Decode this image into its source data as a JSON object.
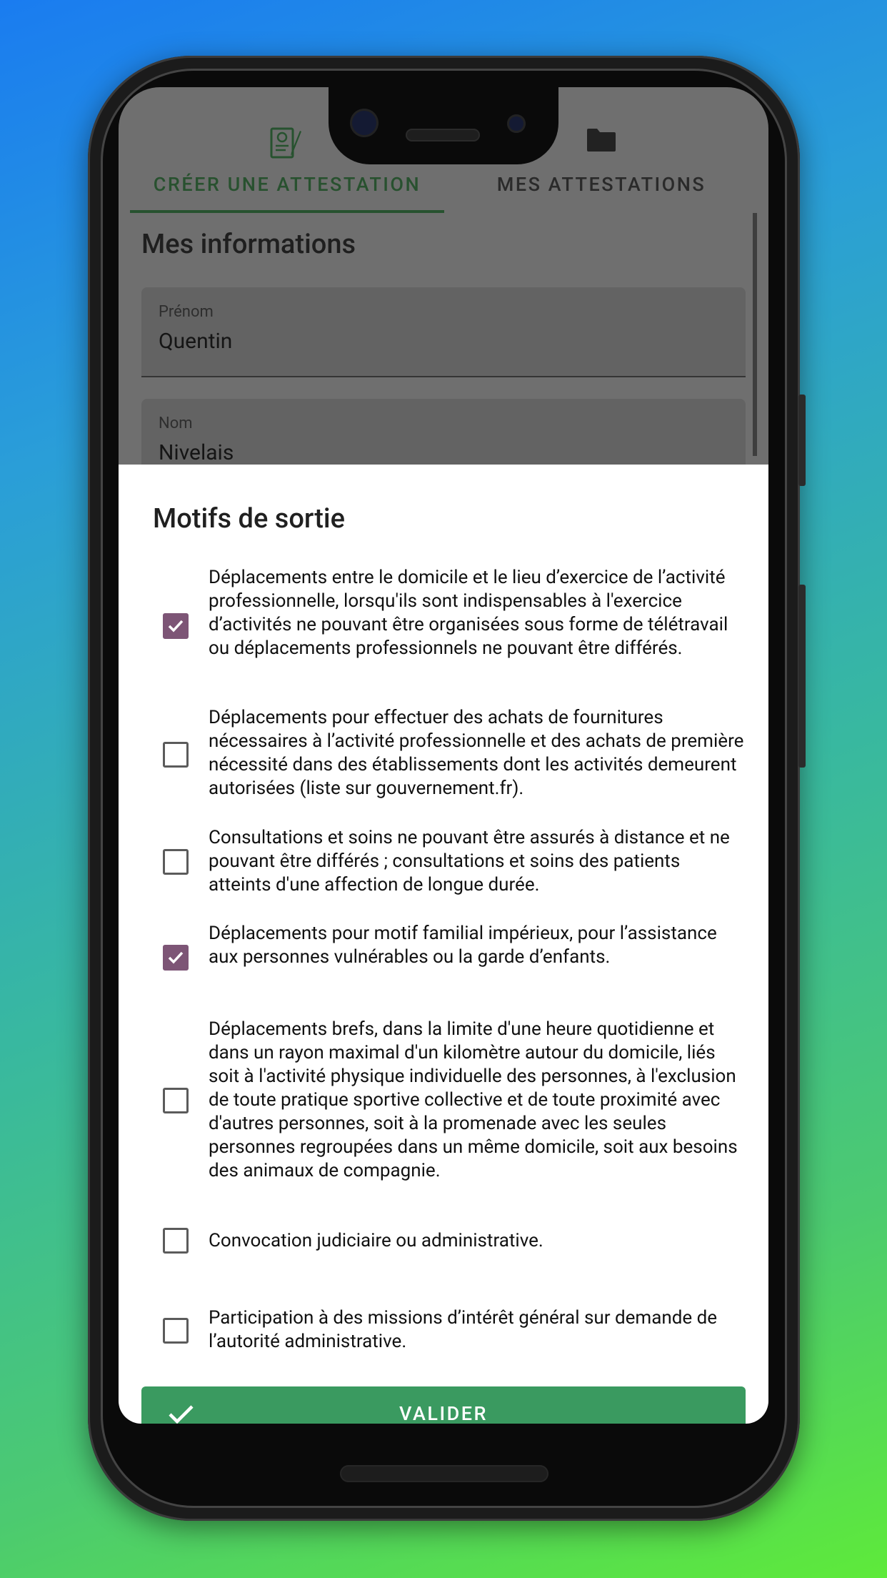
{
  "tabs": [
    {
      "label": "CRÉER UNE ATTESTATION",
      "icon": "certificate-icon",
      "active": true
    },
    {
      "label": "MES ATTESTATIONS",
      "icon": "folder-icon",
      "active": false
    }
  ],
  "form": {
    "section_title": "Mes informations",
    "fields": [
      {
        "label": "Prénom",
        "value": "Quentin"
      },
      {
        "label": "Nom",
        "value": "Nivelais"
      }
    ]
  },
  "dialog": {
    "title": "Motifs de sortie",
    "options": [
      {
        "text": "Déplacements entre le domicile et le lieu d’exercice de l’activité professionnelle, lorsqu'ils sont indispensables à l'exercice d’activités ne pouvant être organisées sous forme de télétravail ou déplacements professionnels ne pouvant être différés.",
        "checked": true
      },
      {
        "text": "Déplacements pour effectuer des achats de fournitures nécessaires à l’activité professionnelle et des achats de première nécessité dans des établissements dont les activités demeurent autorisées (liste sur gouvernement.fr).",
        "checked": false
      },
      {
        "text": "Consultations et soins ne pouvant être assurés à distance et ne pouvant être différés ; consultations et soins des patients atteints d'une affection de longue durée.",
        "checked": false
      },
      {
        "text": "Déplacements pour motif familial impérieux, pour l’assistance aux personnes vulnérables ou la garde d’enfants.",
        "checked": true
      },
      {
        "text": "Déplacements brefs, dans la limite d'une heure quotidienne et dans un rayon maximal d'un kilomètre autour du domicile, liés soit à l'activité physique individuelle des personnes, à l'exclusion de toute pratique sportive collective et de toute proximité avec d'autres personnes, soit à la promenade avec les seules personnes regroupées dans un même domicile, soit aux besoins des animaux de compagnie.",
        "checked": false
      },
      {
        "text": "Convocation judiciaire ou administrative.",
        "checked": false
      },
      {
        "text": "Participation à des missions d’intérêt général sur demande de l’autorité administrative.",
        "checked": false
      }
    ],
    "submit_label": "VALIDER"
  },
  "colors": {
    "accent_green": "#27522f",
    "checkbox_checked": "#7d5576",
    "validate_button": "#3a9a60"
  }
}
